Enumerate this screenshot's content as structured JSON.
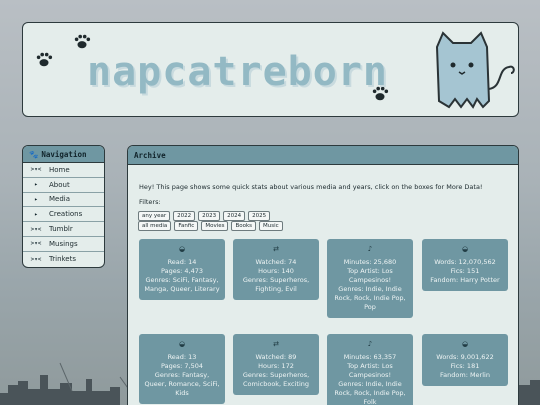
{
  "site": {
    "title": "napcatreborn"
  },
  "nav": {
    "title": "Navigation",
    "items": [
      {
        "marker": ">▾<",
        "label": "Home"
      },
      {
        "marker": "▸",
        "label": "About"
      },
      {
        "marker": "▸",
        "label": "Media"
      },
      {
        "marker": "▸",
        "label": "Creations"
      },
      {
        "marker": ">▾<",
        "label": "Tumblr"
      },
      {
        "marker": ">▾<",
        "label": "Musings"
      },
      {
        "marker": ">▾<",
        "label": "Trinkets"
      }
    ]
  },
  "archive": {
    "title": "Archive",
    "intro": "Hey! This page shows some quick stats about various media and years, click on the boxes for More Data!",
    "filters_label": "Filters:",
    "years": [
      "any year",
      "2022",
      "2023",
      "2024",
      "2025"
    ],
    "media": [
      "all media",
      "Fanfic",
      "Movies",
      "Books",
      "Music"
    ]
  },
  "cards": [
    {
      "icon": "gamepad-icon",
      "glyph": "◒",
      "lines": [
        "Read: 14",
        "Pages: 4,473",
        "Genres: SciFi, Fantasy, Manga, Queer, Literary"
      ]
    },
    {
      "icon": "film-icon",
      "glyph": "⇄",
      "lines": [
        "Watched: 74",
        "Hours: 140",
        "Genres: Superheros, Fighting, Evil"
      ]
    },
    {
      "icon": "music-icon",
      "glyph": "♪",
      "lines": [
        "Minutes: 25,680",
        "Top Artist: Los Campesinos!",
        "Genres: Indie, Indie Rock, Rock, Indie Pop, Pop"
      ]
    },
    {
      "icon": "fanfic-icon",
      "glyph": "◒",
      "lines": [
        "Words: 12,070,562",
        "Fics: 151",
        "Fandom: Harry Potter"
      ]
    },
    {
      "icon": "gamepad-icon",
      "glyph": "◒",
      "lines": [
        "Read: 13",
        "Pages: 7,504",
        "Genres: Fantasy, Queer, Romance, SciFi, Kids"
      ]
    },
    {
      "icon": "film-icon",
      "glyph": "⇄",
      "lines": [
        "Watched: 89",
        "Hours: 172",
        "Genres: Superheros, Comicbook, Exciting"
      ]
    },
    {
      "icon": "music-icon",
      "glyph": "♪",
      "lines": [
        "Minutes: 63,357",
        "Top Artist: Los Campesinos!",
        "Genres: Indie, Indie Rock, Rock, Indie Pop, Folk"
      ]
    },
    {
      "icon": "fanfic-icon",
      "glyph": "◒",
      "lines": [
        "Words: 9,001,622",
        "Fics: 181",
        "Fandom: Merlin"
      ]
    }
  ]
}
